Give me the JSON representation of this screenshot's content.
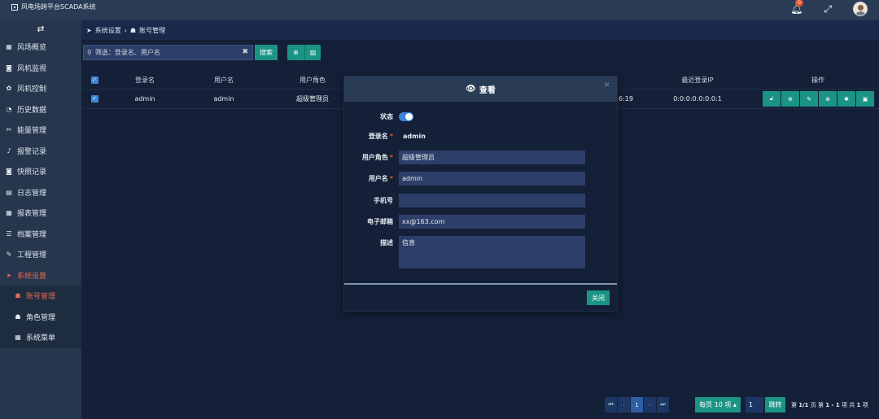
{
  "app": {
    "title": "风电场跨平台SCADA系统"
  },
  "header": {
    "notification_count": "0",
    "bell_icon": "bell-icon",
    "fullscreen_icon": "expand-icon"
  },
  "sidebar": {
    "toggle_icon": "swap-arrows-icon",
    "items": [
      {
        "label": "风场概览",
        "icon": "grid-icon"
      },
      {
        "label": "风机监视",
        "icon": "camera-icon"
      },
      {
        "label": "风机控制",
        "icon": "gear-icon"
      },
      {
        "label": "历史数据",
        "icon": "pie-icon"
      },
      {
        "label": "能量管理",
        "icon": "cut-icon"
      },
      {
        "label": "报警记录",
        "icon": "bell-icon"
      },
      {
        "label": "快照记录",
        "icon": "camera-icon"
      },
      {
        "label": "日志管理",
        "icon": "file-icon"
      },
      {
        "label": "报表管理",
        "icon": "table-icon"
      },
      {
        "label": "档案管理",
        "icon": "list-icon"
      },
      {
        "label": "工程管理",
        "icon": "wrench-icon"
      },
      {
        "label": "系统设置",
        "icon": "location-arrow-icon"
      }
    ],
    "sub_items": [
      {
        "label": "账号管理",
        "icon": "users-icon"
      },
      {
        "label": "角色管理",
        "icon": "user-icon"
      },
      {
        "label": "系统菜单",
        "icon": "grid-icon"
      }
    ]
  },
  "breadcrumb": {
    "parent": "系统设置",
    "separator": "›",
    "current": "账号管理"
  },
  "toolbar": {
    "filter_placeholder": "筛选：登录名、用户名",
    "search_label": "搜索"
  },
  "table": {
    "columns": [
      "登录名",
      "用户名",
      "用户角色",
      "最近登录IP",
      "操作"
    ],
    "rows": [
      {
        "login": "admin",
        "username": "admin",
        "role": "超级管理员",
        "time_tail": "6:19",
        "ip": "0:0:0:0:0:0:0:1"
      }
    ]
  },
  "pagination": {
    "current_page": "1",
    "page_size_label": "每页 10 项",
    "jump_value": "1",
    "jump_label": "跳转",
    "info_prefix": "第",
    "info_page": "1/1",
    "info_page_suffix": "页  第",
    "info_range": "1 - 1",
    "info_range_suffix": "项  共",
    "info_total": "1",
    "info_total_suffix": "项"
  },
  "modal": {
    "title": "查看",
    "fields": {
      "status_label": "状态",
      "login_label": "登录名",
      "login_value": "admin",
      "role_label": "用户角色",
      "role_value": "超级管理员",
      "username_label": "用户名",
      "username_value": "admin",
      "phone_label": "手机号",
      "phone_value": "",
      "email_label": "电子邮箱",
      "email_value": "xx@163.com",
      "desc_label": "描述",
      "desc_value": "信息"
    },
    "close_label": "关闭"
  },
  "colors": {
    "accent_teal": "#1b9484",
    "active_red": "#e26b52",
    "header_bg": "#2a3c55"
  }
}
